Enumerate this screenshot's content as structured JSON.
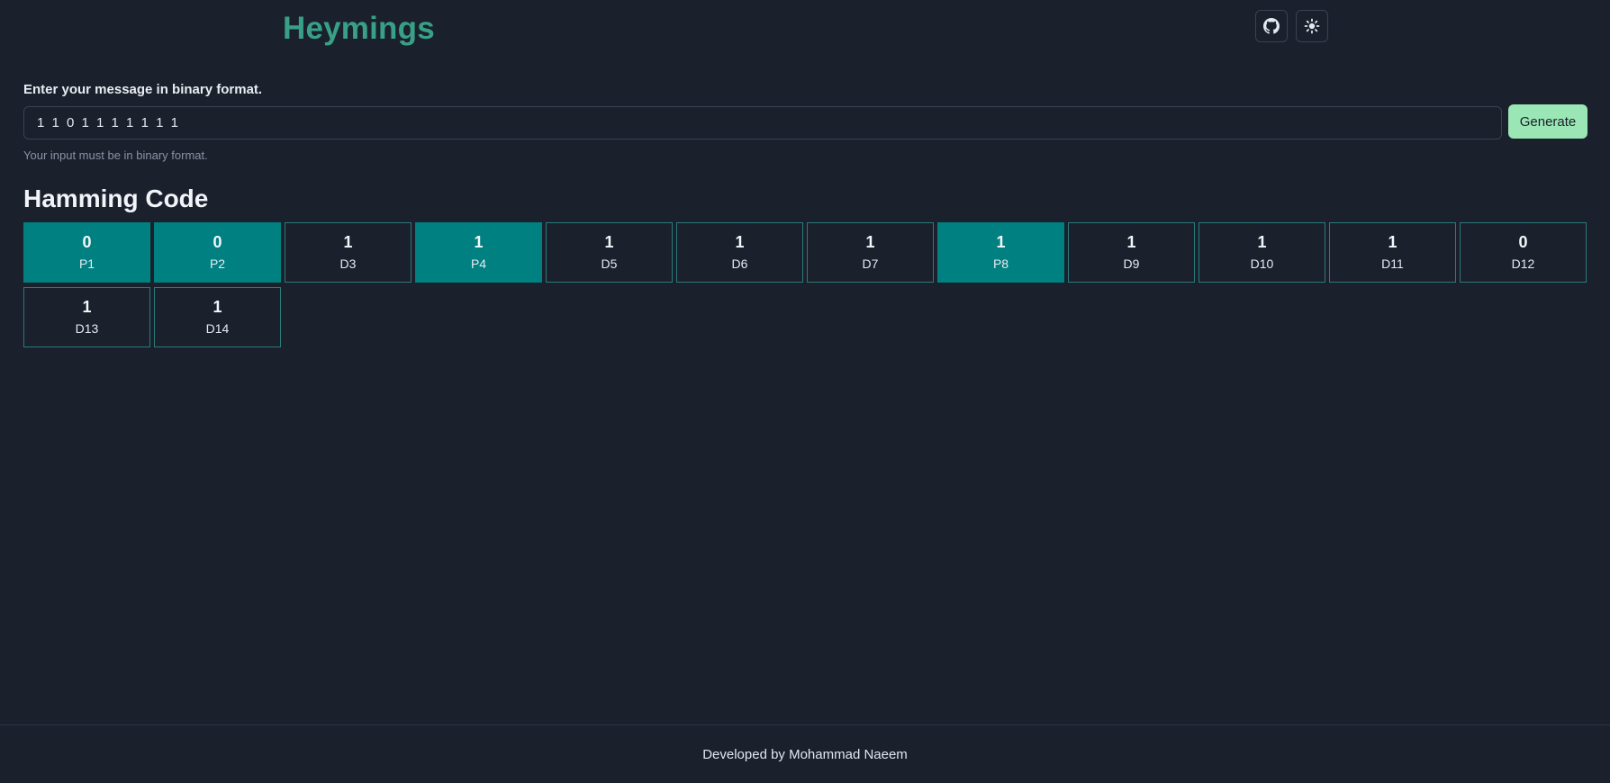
{
  "header": {
    "brand": "Heymings",
    "github_icon": "github-icon",
    "theme_icon": "sun-icon"
  },
  "form": {
    "label": "Enter your message in binary format.",
    "input_value": "1 1 0 1 1 1 1 1 1 1",
    "placeholder": "",
    "generate_label": "Generate",
    "helper_text": "Your input must be in binary format."
  },
  "hamming": {
    "title": "Hamming Code",
    "cells": [
      {
        "value": "0",
        "label": "P1",
        "parity": true
      },
      {
        "value": "0",
        "label": "P2",
        "parity": true
      },
      {
        "value": "1",
        "label": "D3",
        "parity": false
      },
      {
        "value": "1",
        "label": "P4",
        "parity": true
      },
      {
        "value": "1",
        "label": "D5",
        "parity": false
      },
      {
        "value": "1",
        "label": "D6",
        "parity": false
      },
      {
        "value": "1",
        "label": "D7",
        "parity": false
      },
      {
        "value": "1",
        "label": "P8",
        "parity": true
      },
      {
        "value": "1",
        "label": "D9",
        "parity": false
      },
      {
        "value": "1",
        "label": "D10",
        "parity": false
      },
      {
        "value": "1",
        "label": "D11",
        "parity": false
      },
      {
        "value": "0",
        "label": "D12",
        "parity": false
      },
      {
        "value": "1",
        "label": "D13",
        "parity": false
      },
      {
        "value": "1",
        "label": "D14",
        "parity": false
      }
    ]
  },
  "footer": {
    "text": "Developed by Mohammad Naeem"
  },
  "colors": {
    "background": "#1a202c",
    "brand": "#38a087",
    "parity_cell": "#008080",
    "cell_border": "#2c7a7b",
    "button": "#9ae6b4"
  }
}
